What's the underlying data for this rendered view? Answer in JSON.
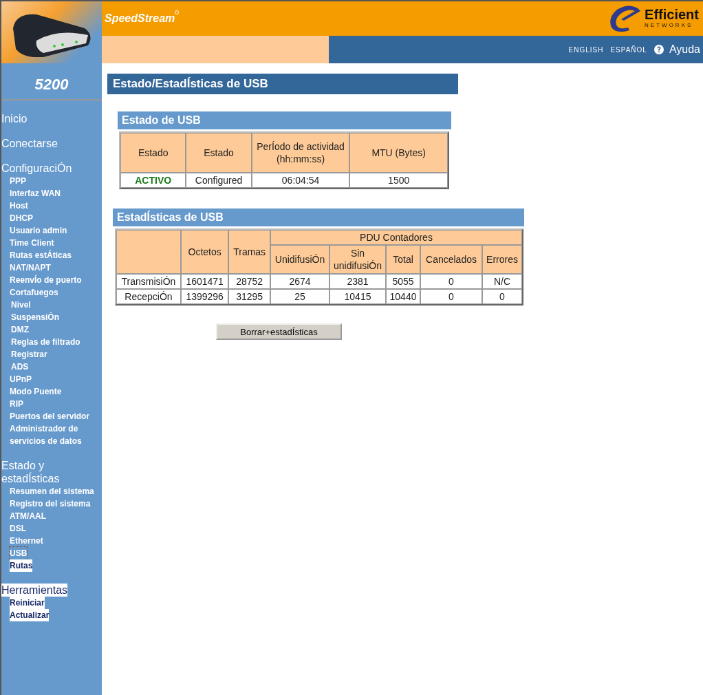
{
  "header": {
    "brand": "SpeedStream",
    "logo_name": "Efficient",
    "logo_tagline": "NETWORKS",
    "languages": [
      "ENGLISH",
      "ESPAÑOL"
    ],
    "help": "Ayuda"
  },
  "model": "5200",
  "sidebar": {
    "items": [
      {
        "label": "Inicio",
        "selected": false,
        "highlighted": false
      },
      {
        "label": "Conectarse",
        "selected": false,
        "highlighted": false
      },
      {
        "label": "ConfiguraciÓn",
        "selected": false,
        "highlighted": false,
        "children": [
          {
            "label": "PPP",
            "selected": false,
            "highlighted": false
          },
          {
            "label": "Interfaz WAN",
            "selected": false,
            "highlighted": false
          },
          {
            "label": "Host",
            "selected": false,
            "highlighted": false
          },
          {
            "label": "DHCP",
            "selected": false,
            "highlighted": false
          },
          {
            "label": "Usuario admin",
            "selected": false,
            "highlighted": false
          },
          {
            "label": "Time Client",
            "selected": false,
            "highlighted": false
          },
          {
            "label": "Rutas estÁticas",
            "selected": false,
            "highlighted": false
          },
          {
            "label": "NAT/NAPT",
            "selected": false,
            "highlighted": false
          },
          {
            "label": "ReenvÍo de puerto",
            "selected": false,
            "highlighted": false
          },
          {
            "label": "Cortafuegos",
            "selected": false,
            "highlighted": false,
            "children": [
              {
                "label": "Nivel",
                "selected": false,
                "highlighted": false
              },
              {
                "label": "SuspensiÓn",
                "selected": false,
                "highlighted": false
              },
              {
                "label": "DMZ",
                "selected": false,
                "highlighted": false
              },
              {
                "label": "Reglas de filtrado",
                "selected": false,
                "highlighted": false
              },
              {
                "label": "Registrar",
                "selected": false,
                "highlighted": false
              },
              {
                "label": "ADS",
                "selected": false,
                "highlighted": false
              }
            ]
          },
          {
            "label": "UPnP",
            "selected": false,
            "highlighted": false
          },
          {
            "label": "Modo Puente",
            "selected": false,
            "highlighted": false
          },
          {
            "label": "RIP",
            "selected": false,
            "highlighted": false
          },
          {
            "label": "Puertos del servidor",
            "selected": false,
            "highlighted": false
          },
          {
            "label": "Administrador de servicios de datos",
            "selected": false,
            "highlighted": false
          }
        ]
      },
      {
        "label": "Estado y estadÍsticas",
        "selected": false,
        "highlighted": false,
        "children": [
          {
            "label": "Resumen del sistema",
            "selected": false,
            "highlighted": false
          },
          {
            "label": "Registro del sistema",
            "selected": false,
            "highlighted": false
          },
          {
            "label": "ATM/AAL",
            "selected": false,
            "highlighted": false
          },
          {
            "label": "DSL",
            "selected": false,
            "highlighted": false
          },
          {
            "label": "Ethernet",
            "selected": false,
            "highlighted": false
          },
          {
            "label": "USB",
            "selected": true,
            "highlighted": false
          },
          {
            "label": "Rutas",
            "selected": false,
            "highlighted": true
          }
        ]
      },
      {
        "label": "Herramientas",
        "selected": false,
        "highlighted": true,
        "children": [
          {
            "label": "Reiniciar",
            "selected": false,
            "highlighted": true
          },
          {
            "label": "Actualizar",
            "selected": false,
            "highlighted": true
          }
        ]
      }
    ]
  },
  "page_title": "Estado/EstadÍsticas de USB",
  "status_section": {
    "title": "Estado de USB",
    "columns": [
      "Estado",
      "Estado",
      "PerÍodo de actividad (hh:mm:ss)",
      "MTU (Bytes)"
    ],
    "rows": [
      {
        "active": true,
        "cells": [
          "ACTIVO",
          "Configured",
          "06:04:54",
          "1500"
        ]
      }
    ]
  },
  "stats_section": {
    "title": "EstadÍsticas de USB",
    "columns": [
      "Octetos",
      "Tramas"
    ],
    "group": {
      "label": "PDU Contadores",
      "columns": [
        "UnidifusiÓn",
        "Sin unidifusiÓn",
        "Total",
        "Cancelados",
        "Errores"
      ]
    },
    "rows": [
      {
        "label": "TransmisiÓn",
        "values": [
          "1601471",
          "28752",
          "2674",
          "2381",
          "5055",
          "0",
          "N/C"
        ]
      },
      {
        "label": "RecepciÓn",
        "values": [
          "1399296",
          "31295",
          "25",
          "10415",
          "10440",
          "0",
          "0"
        ]
      }
    ]
  },
  "button": "Borrar+estadÍsticas"
}
